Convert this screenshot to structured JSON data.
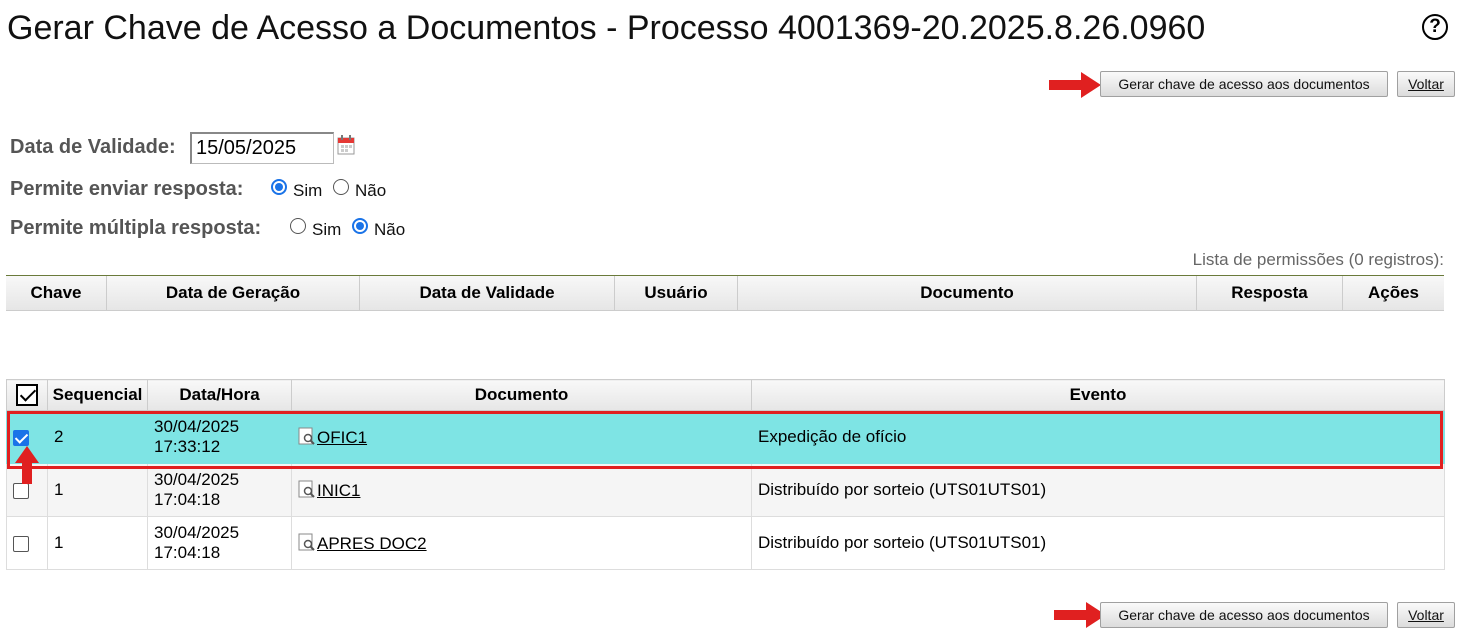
{
  "page": {
    "title": "Gerar Chave de Acesso a Documentos - Processo 4001369-20.2025.8.26.0960",
    "help_glyph": "?"
  },
  "toolbar": {
    "generate_label": "Gerar chave de acesso aos documentos",
    "back_label": "Voltar"
  },
  "form": {
    "validity_label": "Data de Validade:",
    "validity_value": "15/05/2025",
    "send_response_label": "Permite enviar resposta:",
    "send_response_value": "Sim",
    "multiple_response_label": "Permite múltipla resposta:",
    "multiple_response_value": "Não",
    "option_yes": "Sim",
    "option_no": "Não"
  },
  "permissions": {
    "caption": "Lista de permissões (0 registros):",
    "columns": [
      "Chave",
      "Data de Geração",
      "Data de Validade",
      "Usuário",
      "Documento",
      "Resposta",
      "Ações"
    ]
  },
  "documents": {
    "columns": [
      "Sequencial",
      "Data/Hora",
      "Documento",
      "Evento"
    ],
    "rows": [
      {
        "checked": true,
        "seq": "2",
        "date": "30/04/2025",
        "time": "17:33:12",
        "doc": "OFIC1",
        "event": "Expedição de ofício"
      },
      {
        "checked": false,
        "seq": "1",
        "date": "30/04/2025",
        "time": "17:04:18",
        "doc": "INIC1",
        "event": "Distribuído por sorteio (UTS01UTS01)"
      },
      {
        "checked": false,
        "seq": "1",
        "date": "30/04/2025",
        "time": "17:04:18",
        "doc": "APRES DOC2",
        "event": "Distribuído por sorteio (UTS01UTS01)"
      }
    ]
  },
  "icons": {
    "help": "help-circle-icon",
    "calendar": "calendar-icon",
    "document": "document-magnifier-icon",
    "annotation_arrow": "red-arrow-icon"
  },
  "colors": {
    "selected_row": "#7ee4e4",
    "annotation": "#e02020",
    "radio_accent": "#1a73e8"
  }
}
